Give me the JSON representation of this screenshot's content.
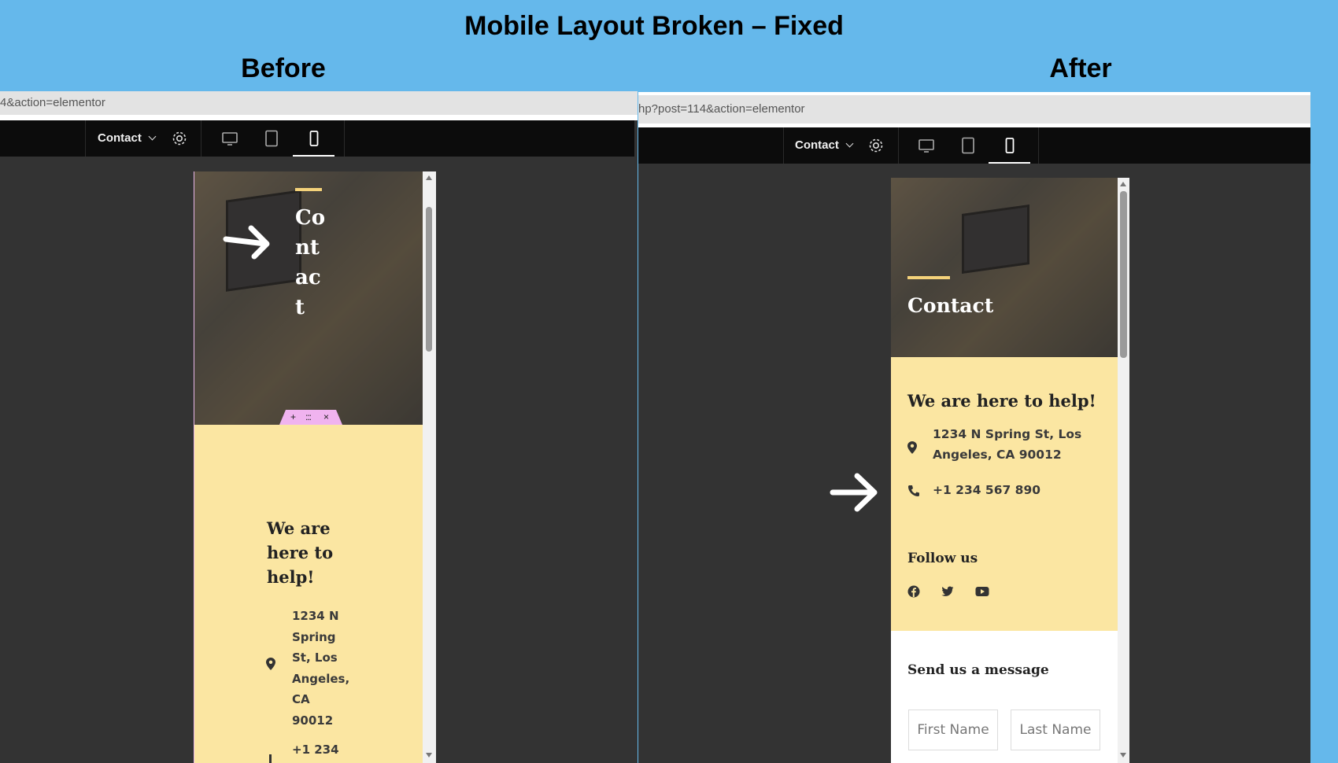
{
  "title": "Mobile Layout Broken – Fixed",
  "labels": {
    "before": "Before",
    "after": "After"
  },
  "before": {
    "url_text": "4&action=elementor",
    "toolbar": {
      "page_label": "Contact"
    },
    "hero_title_lines": [
      "Co",
      "nt",
      "ac",
      "t"
    ],
    "section_controls": {
      "add": "+",
      "drag": ":::",
      "close": "×"
    },
    "heading_lines": [
      "We are",
      "here to",
      "help!"
    ],
    "address_lines": [
      "1234 N",
      "Spring",
      "St, Los",
      "Angeles,",
      "CA",
      "90012"
    ],
    "phone_partial": "+1 234"
  },
  "after": {
    "url_text": "hp?post=114&action=elementor",
    "toolbar": {
      "page_label": "Contact"
    },
    "hero_title": "Contact",
    "heading": "We are here to help!",
    "address_lines": [
      "1234 N Spring St, Los",
      "Angeles, CA 90012"
    ],
    "phone": "+1 234 567 890",
    "follow_title": "Follow us",
    "social": [
      "facebook-icon",
      "twitter-icon",
      "youtube-icon"
    ],
    "message_title": "Send us a message",
    "form": {
      "first_name_placeholder": "First Name",
      "last_name_placeholder": "Last Name"
    }
  },
  "colors": {
    "background": "#65b8eb",
    "panel": "#333333",
    "toolbar": "#0c0c0c",
    "card": "#fbe6a2",
    "accent": "#f4d27a"
  }
}
